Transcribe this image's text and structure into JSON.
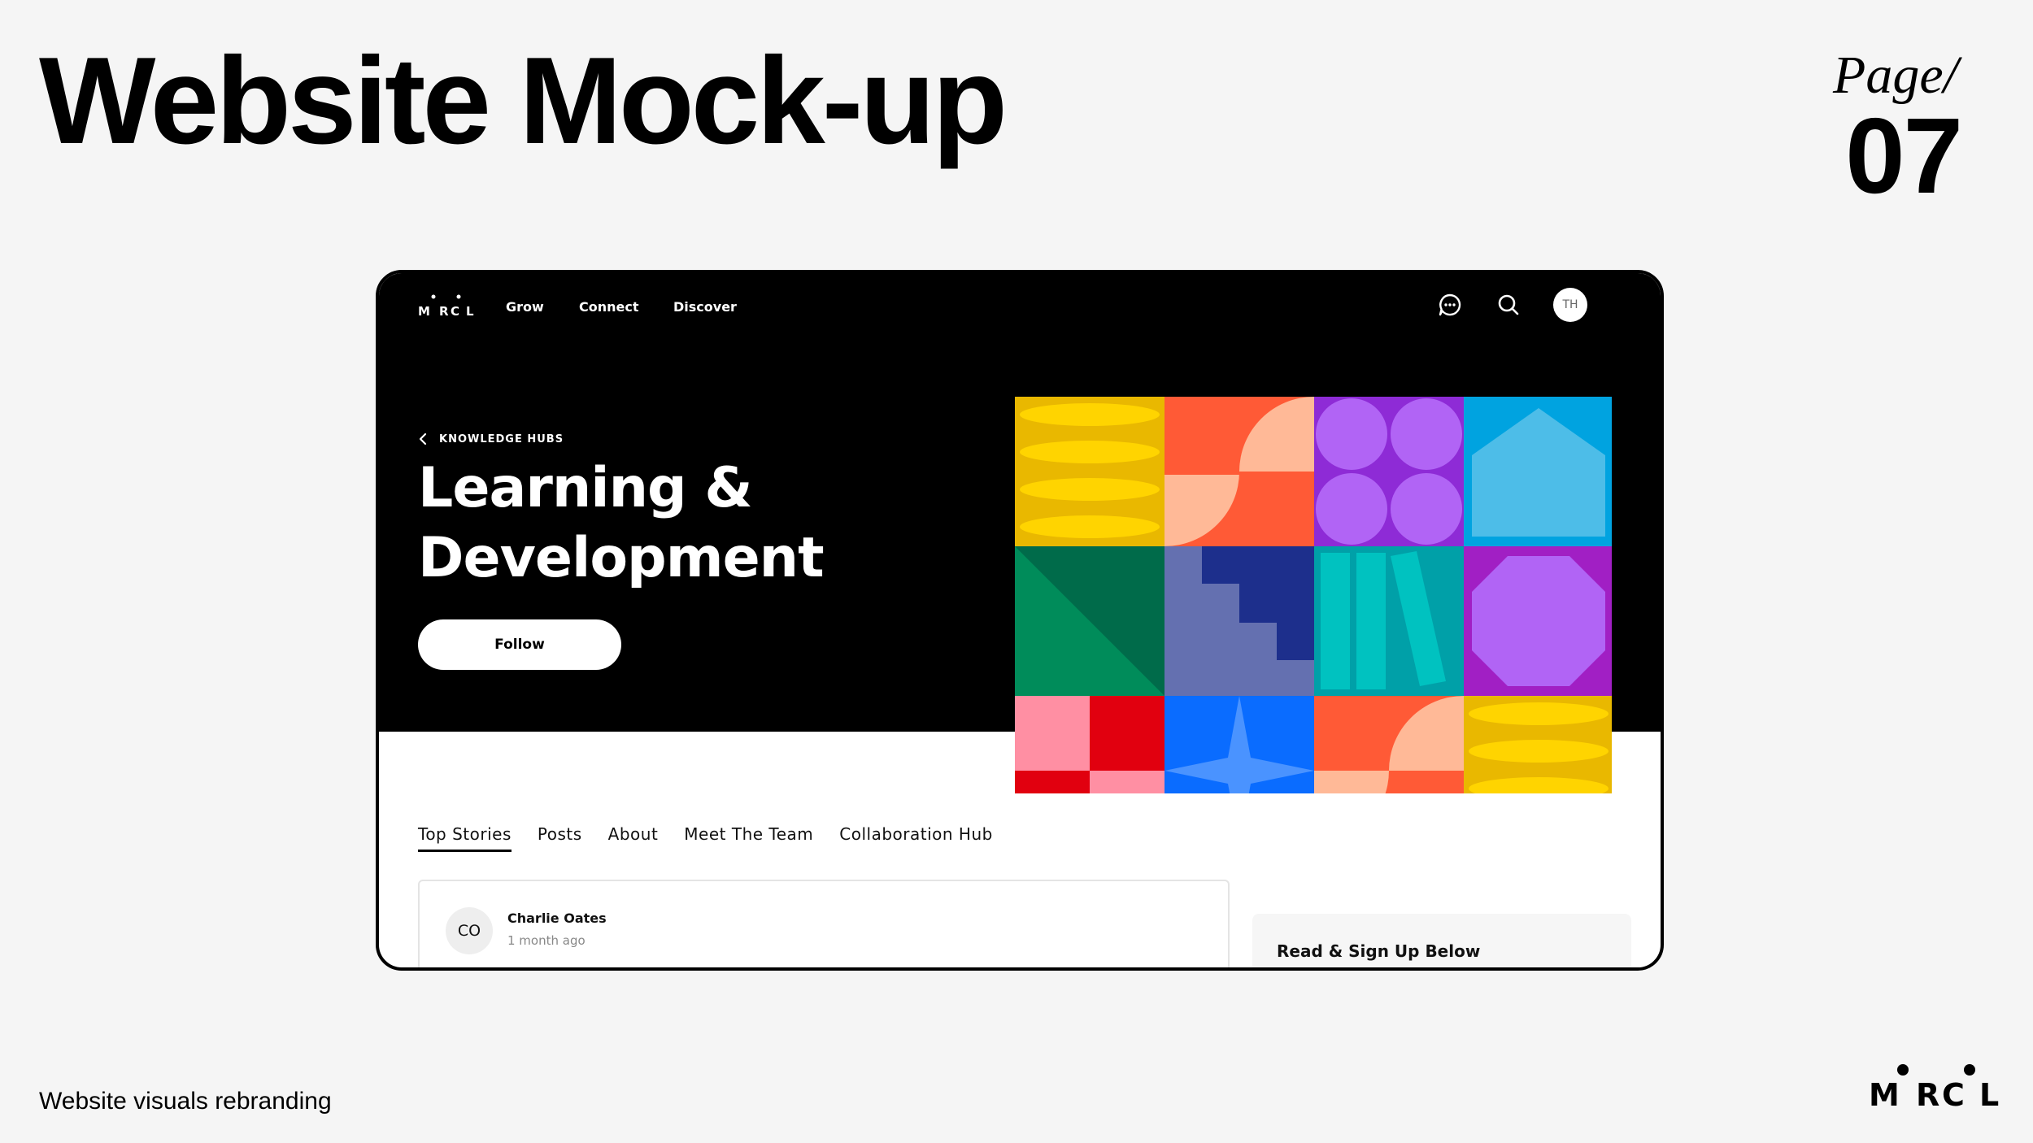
{
  "slide": {
    "title": "Website Mock-up",
    "page_word": "Page/",
    "page_number": "07",
    "footer": "Website visuals rebranding",
    "brand_letters": [
      "M",
      "R",
      "C",
      "L"
    ]
  },
  "mockup": {
    "nav": {
      "logo_letters": [
        "M",
        "R",
        "C",
        "L"
      ],
      "links": [
        "Grow",
        "Connect",
        "Discover"
      ],
      "icons": [
        "chat-icon",
        "search-icon"
      ],
      "avatar_initials": "TH"
    },
    "hero": {
      "breadcrumb": "KNOWLEDGE HUBS",
      "title": "Learning & Development",
      "follow_label": "Follow"
    },
    "tabs": [
      "Top Stories",
      "Posts",
      "About",
      "Meet The Team",
      "Collaboration Hub"
    ],
    "active_tab": "Top Stories",
    "post": {
      "avatar_initials": "CO",
      "author": "Charlie Oates",
      "time": "1 month ago"
    },
    "sidebar": {
      "title": "Read & Sign Up Below"
    },
    "colors": {
      "yellow": "#e9b800",
      "orange": "#ff5a36",
      "peach": "#ffb997",
      "purple": "#8e2bd6",
      "lilac": "#b164f5",
      "sky": "#00a3e0",
      "green": "#008c5a",
      "navy": "#1d2f8c",
      "teal": "#00b5b8",
      "pink": "#ff8fa3",
      "red": "#e1000f",
      "blue": "#0a6cff"
    }
  }
}
